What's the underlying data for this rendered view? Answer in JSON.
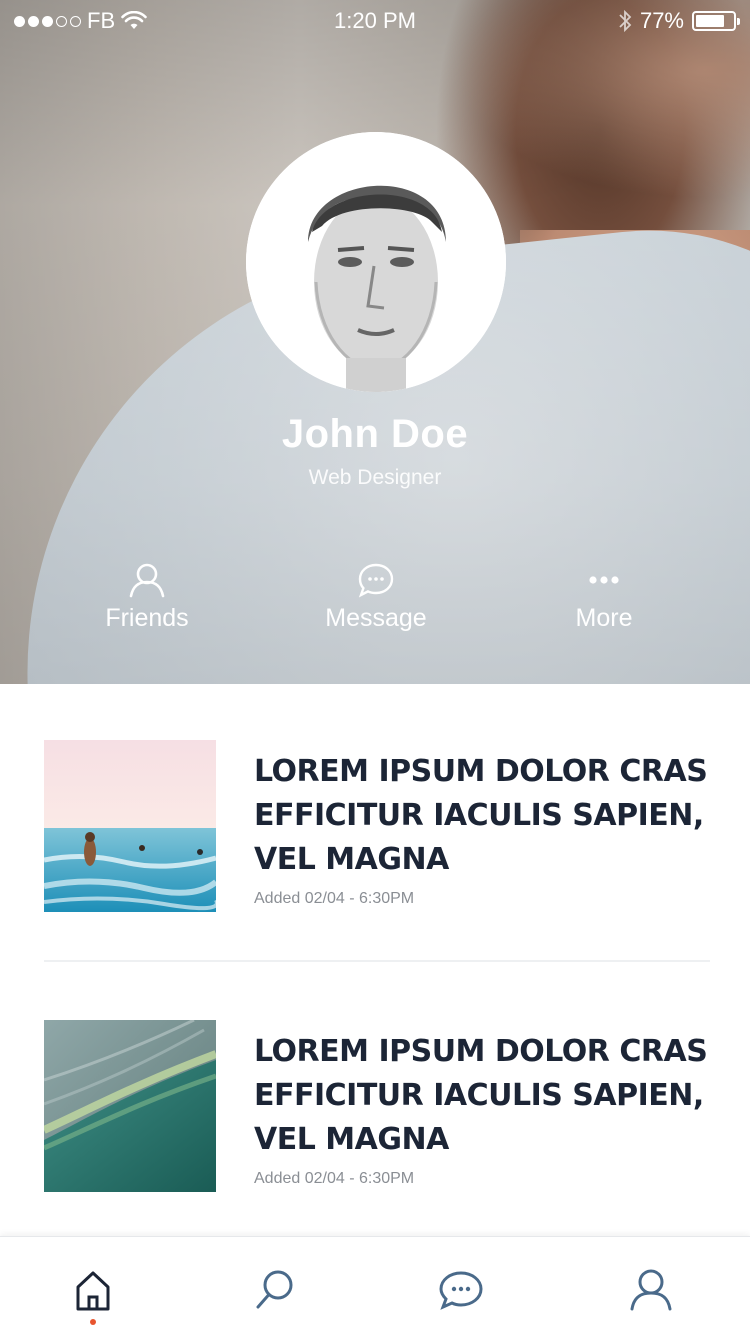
{
  "status_bar": {
    "carrier": "FB",
    "time": "1:20 PM",
    "battery_percent": "77%",
    "battery_level": 0.77,
    "signal_bars_filled": 3,
    "signal_bars_total": 5
  },
  "profile": {
    "name": "John Doe",
    "role": "Web Designer"
  },
  "actions": [
    {
      "label": "Friends",
      "icon": "person-icon"
    },
    {
      "label": "Message",
      "icon": "chat-bubble-icon"
    },
    {
      "label": "More",
      "icon": "more-dots-icon"
    }
  ],
  "feed": [
    {
      "title": "LOREM IPSUM DOLOR CRAS EFFICITUR IACULIS SAPIEN, VEL MAGNA",
      "meta": "Added 02/04 - 6:30PM",
      "image": "ocean-swimmers-photo"
    },
    {
      "title": "LOREM IPSUM DOLOR CRAS EFFICITUR IACULIS SAPIEN, VEL MAGNA",
      "meta": "Added 02/04 - 6:30PM",
      "image": "aerial-coastline-photo"
    }
  ],
  "tabbar": {
    "items": [
      {
        "name": "home",
        "icon": "home-icon",
        "active": true
      },
      {
        "name": "search",
        "icon": "search-icon",
        "active": false
      },
      {
        "name": "messages",
        "icon": "chat-bubble-icon",
        "active": false
      },
      {
        "name": "profile",
        "icon": "person-icon",
        "active": false
      }
    ]
  },
  "colors": {
    "title_text": "#1c2536",
    "meta_text": "#8a8e94",
    "tab_icon": "#4a6a8a",
    "tab_icon_active": "#1c2536",
    "active_indicator": "#e8542e"
  }
}
